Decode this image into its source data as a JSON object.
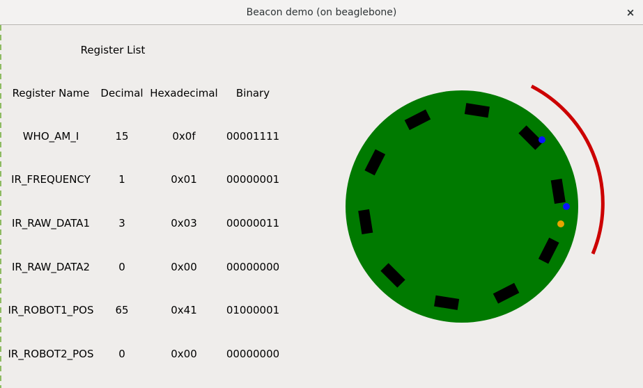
{
  "window": {
    "title": "Beacon demo (on beaglebone)",
    "close_glyph": "×"
  },
  "register_panel": {
    "title": "Register List",
    "columns": [
      "Register Name",
      "Decimal",
      "Hexadecimal",
      "Binary"
    ],
    "rows": [
      {
        "name": "WHO_AM_I",
        "decimal": "15",
        "hex": "0x0f",
        "binary": "00001111"
      },
      {
        "name": "IR_FREQUENCY",
        "decimal": "1",
        "hex": "0x01",
        "binary": "00000001"
      },
      {
        "name": "IR_RAW_DATA1",
        "decimal": "3",
        "hex": "0x03",
        "binary": "00000011"
      },
      {
        "name": "IR_RAW_DATA2",
        "decimal": "0",
        "hex": "0x00",
        "binary": "00000000"
      },
      {
        "name": "IR_ROBOT1_POS",
        "decimal": "65",
        "hex": "0x41",
        "binary": "01000001"
      },
      {
        "name": "IR_ROBOT2_POS",
        "decimal": "0",
        "hex": "0x00",
        "binary": "00000000"
      }
    ]
  },
  "beacon_view": {
    "body_color": "#007a00",
    "sensor_color": "#000000",
    "arc_color": "#cc0000",
    "dot_blue": "#0a14ff",
    "dot_orange": "#e8a400",
    "sensor_count": 10
  }
}
